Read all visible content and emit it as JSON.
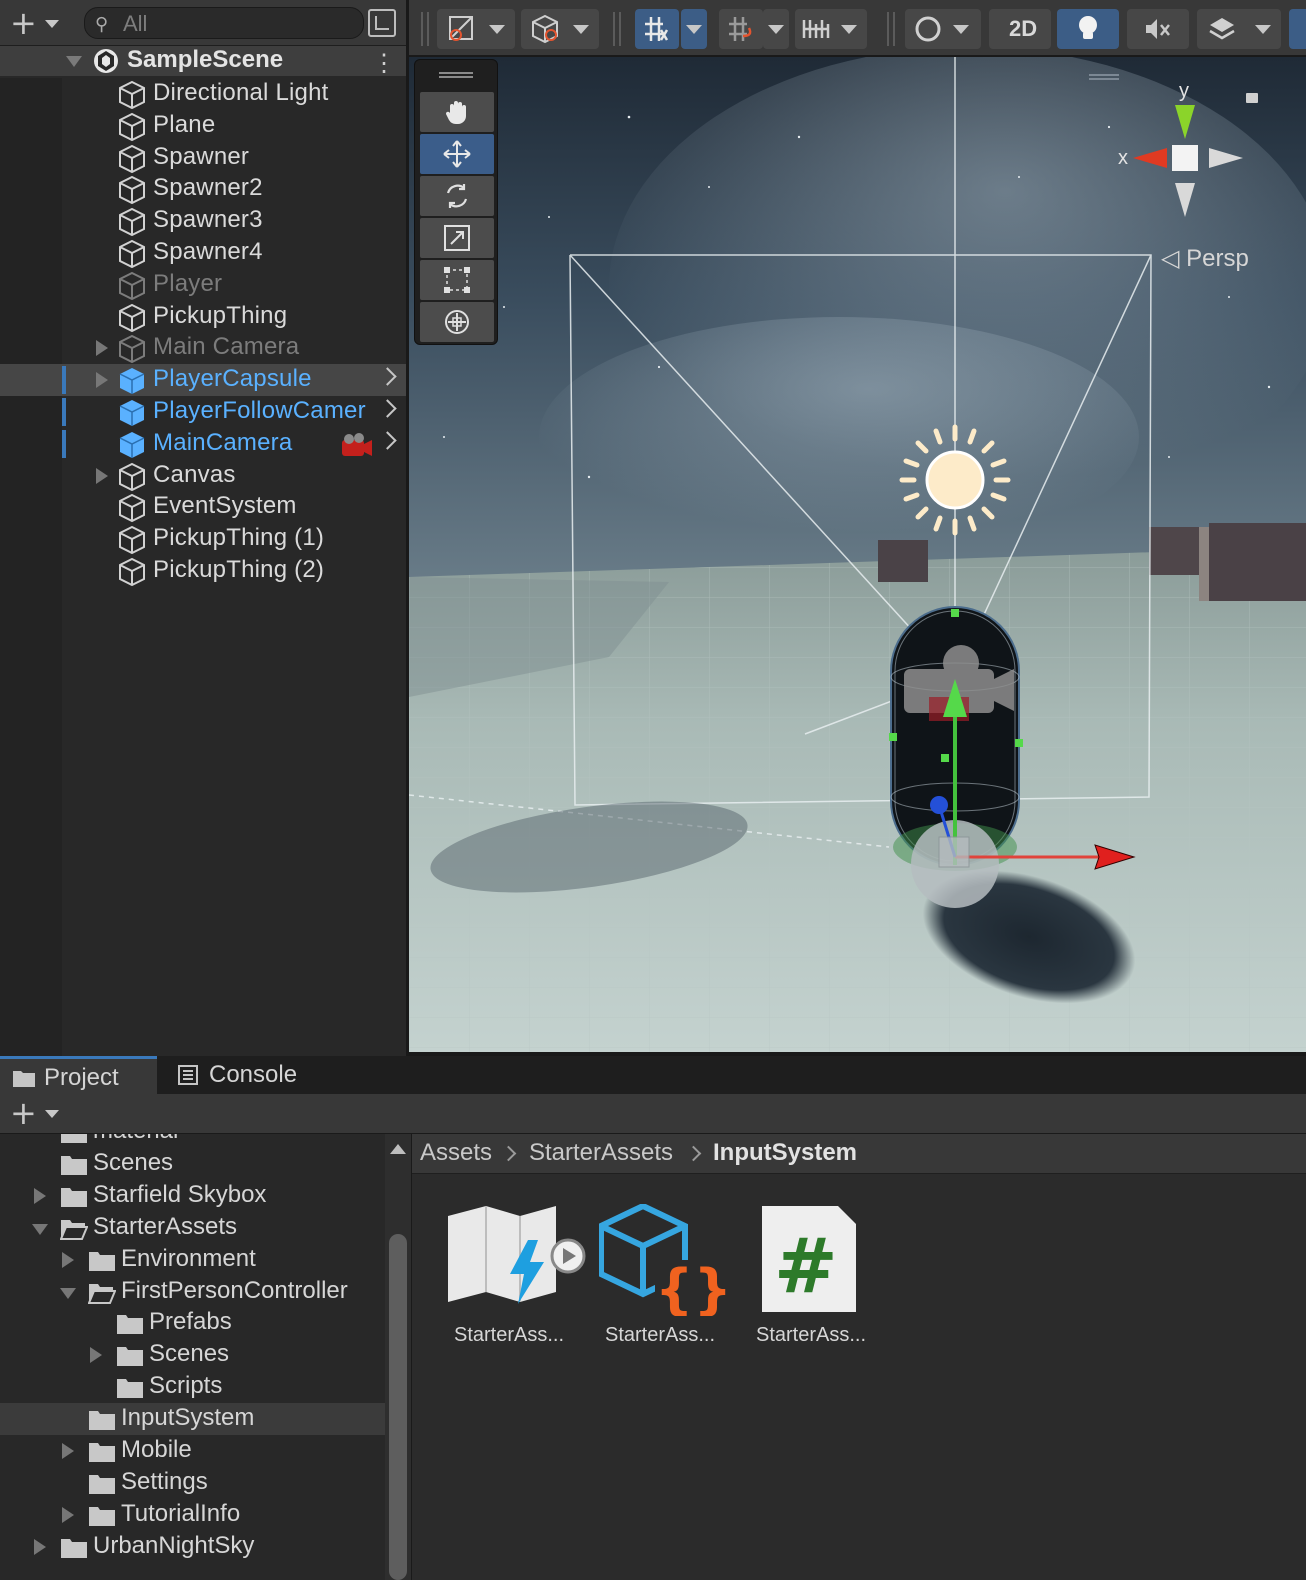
{
  "hierarchy": {
    "search_placeholder": "All",
    "scene": {
      "title": "SampleScene"
    },
    "items": [
      {
        "label": "Directional Light",
        "state": "normal",
        "foldout": false
      },
      {
        "label": "Plane",
        "state": "normal",
        "foldout": false
      },
      {
        "label": "Spawner",
        "state": "normal",
        "foldout": false
      },
      {
        "label": "Spawner2",
        "state": "normal",
        "foldout": false
      },
      {
        "label": "Spawner3",
        "state": "normal",
        "foldout": false
      },
      {
        "label": "Spawner4",
        "state": "normal",
        "foldout": false
      },
      {
        "label": "Player",
        "state": "inactive",
        "foldout": false
      },
      {
        "label": "PickupThing",
        "state": "normal",
        "foldout": false
      },
      {
        "label": "Main Camera",
        "state": "inactive",
        "foldout": true
      },
      {
        "label": "PlayerCapsule",
        "state": "prefab-selected",
        "foldout": true
      },
      {
        "label": "PlayerFollowCamer",
        "state": "prefab-blue",
        "foldout": false
      },
      {
        "label": "MainCamera",
        "state": "prefab-blue-badge",
        "foldout": false
      },
      {
        "label": "Canvas",
        "state": "normal",
        "foldout": true
      },
      {
        "label": "EventSystem",
        "state": "normal",
        "foldout": false
      },
      {
        "label": "PickupThing (1)",
        "state": "normal",
        "foldout": false
      },
      {
        "label": "PickupThing (2)",
        "state": "normal",
        "foldout": false
      }
    ]
  },
  "scene_view": {
    "toolbar": {
      "mode_2d_label": "2D"
    },
    "tools": [
      "hand-tool",
      "move-tool",
      "rotate-tool",
      "scale-tool",
      "rect-tool",
      "transform-tool"
    ],
    "active_tool": "move-tool",
    "gizmo": {
      "y_label": "y",
      "x_label": "x",
      "projection_label": "Persp"
    }
  },
  "bottom_panel": {
    "tabs": [
      {
        "label": "Project",
        "icon": "folder-icon",
        "active": true
      },
      {
        "label": "Console",
        "icon": "console-icon",
        "active": false
      }
    ],
    "tree": [
      {
        "label": "material",
        "depth": 0,
        "fold": "none"
      },
      {
        "label": "Scenes",
        "depth": 0,
        "fold": "none"
      },
      {
        "label": "Starfield Skybox",
        "depth": 0,
        "fold": "closed"
      },
      {
        "label": "StarterAssets",
        "depth": 0,
        "fold": "open"
      },
      {
        "label": "Environment",
        "depth": 1,
        "fold": "closed"
      },
      {
        "label": "FirstPersonController",
        "depth": 1,
        "fold": "open"
      },
      {
        "label": "Prefabs",
        "depth": 2,
        "fold": "none"
      },
      {
        "label": "Scenes",
        "depth": 2,
        "fold": "closed"
      },
      {
        "label": "Scripts",
        "depth": 2,
        "fold": "none"
      },
      {
        "label": "InputSystem",
        "depth": 1,
        "fold": "none",
        "selected": true
      },
      {
        "label": "Mobile",
        "depth": 1,
        "fold": "closed"
      },
      {
        "label": "Settings",
        "depth": 1,
        "fold": "none"
      },
      {
        "label": "TutorialInfo",
        "depth": 1,
        "fold": "closed"
      },
      {
        "label": "UrbanNightSky",
        "depth": 0,
        "fold": "closed"
      }
    ],
    "breadcrumb": [
      "Assets",
      "StarterAssets",
      "InputSystem"
    ],
    "assets": [
      {
        "label": "StarterAss...",
        "icon": "input-actions-icon"
      },
      {
        "label": "StarterAss...",
        "icon": "json-asset-icon"
      },
      {
        "label": "StarterAss...",
        "icon": "csharp-script-icon"
      }
    ]
  }
}
